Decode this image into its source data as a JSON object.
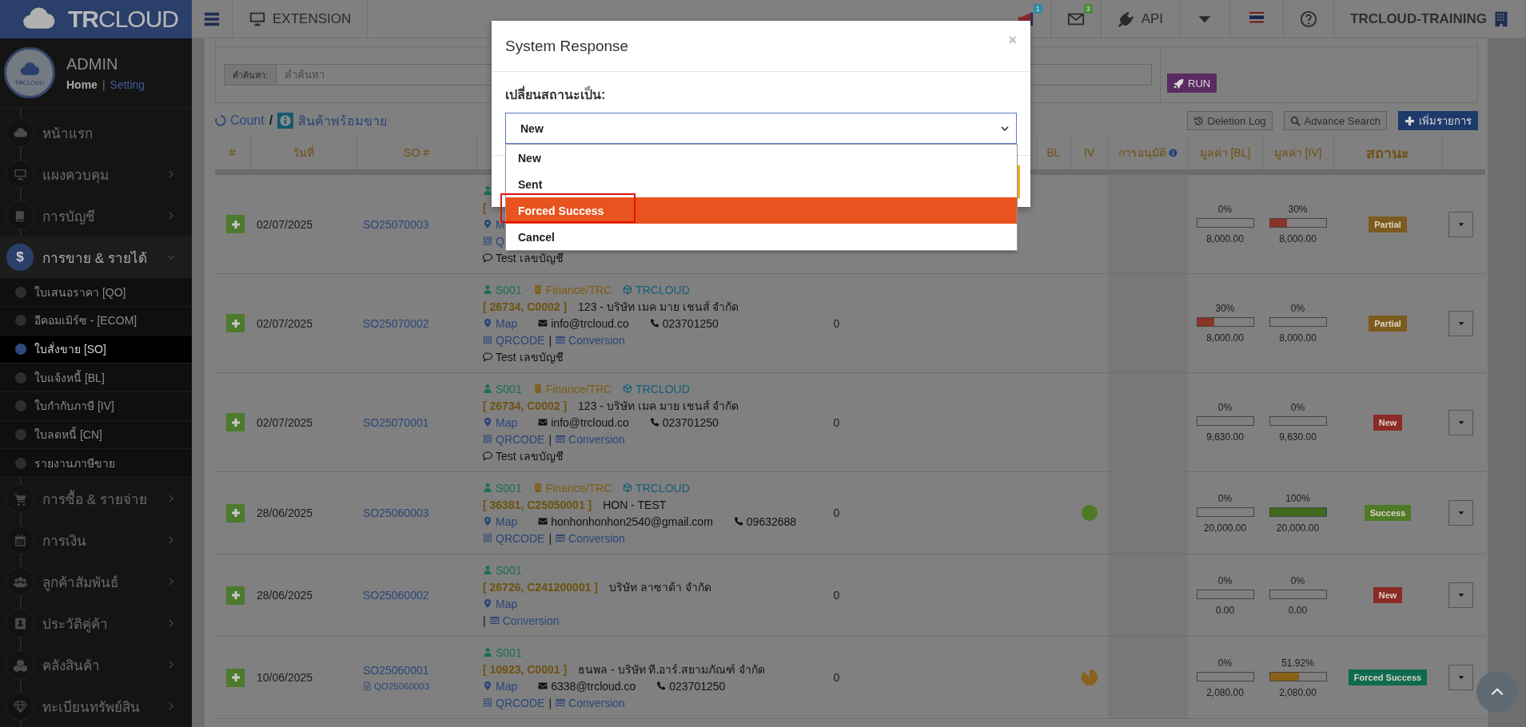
{
  "brand": {
    "logo": "**TR**CLOUD"
  },
  "topbar": {
    "extension": "EXTENSION",
    "items": [
      {
        "kind": "announce",
        "badge": "1",
        "color": "#2f8ea6"
      },
      {
        "kind": "mail",
        "badge": "3",
        "color": "#4a8a34"
      },
      {
        "kind": "api",
        "label": "API"
      },
      {
        "kind": "caret"
      },
      {
        "kind": "flag"
      },
      {
        "kind": "help"
      },
      {
        "kind": "company",
        "label": "TRCLOUD-TRAINING"
      }
    ]
  },
  "sidebar": {
    "profile": {
      "logo": "**TR**CLOUD",
      "name": "ADMIN",
      "links": [
        "Home",
        "Setting"
      ],
      "separator": "|"
    },
    "items": [
      {
        "label": "หน้าแรก",
        "kind": "cloud",
        "expandable": false,
        "expanded": false
      },
      {
        "label": "แผงควบคุม",
        "kind": "monitor",
        "expandable": true,
        "expanded": false
      },
      {
        "label": "การบัญชี",
        "kind": "book",
        "expandable": true,
        "expanded": false
      },
      {
        "label": "การขาย & รายได้",
        "kind": "dollar",
        "glyph": "$",
        "expandable": true,
        "expanded": true,
        "children": [
          {
            "label": "ใบเสนอราคา [QO]",
            "selected": false
          },
          {
            "label": "อีคอมเมิร์ซ - [ECOM]",
            "selected": false
          },
          {
            "label": "ใบสั่งขาย [SO]",
            "selected": true
          },
          {
            "label": "ใบแจ้งหนี้ [BL]",
            "selected": false
          },
          {
            "label": "ใบกำกับภาษี [IV]",
            "selected": false
          },
          {
            "label": "ใบลดหนี้ [CN]",
            "selected": false
          },
          {
            "label": "รายงานภาษีขาย",
            "selected": false
          }
        ]
      },
      {
        "label": "การซื้อ & รายจ่าย",
        "kind": "cart",
        "expandable": true,
        "expanded": false
      },
      {
        "label": "การเงิน",
        "kind": "calendar",
        "expandable": true,
        "expanded": false
      },
      {
        "label": "ลูกค้าสัมพันธ์",
        "kind": "users",
        "expandable": true,
        "expanded": false
      },
      {
        "label": "ประวัติคู่ค้า",
        "kind": "contact",
        "expandable": true,
        "expanded": false
      },
      {
        "label": "คลังสินค้า",
        "kind": "boxes",
        "expandable": true,
        "expanded": false
      },
      {
        "label": "ทะเบียนทรัพย์สิน",
        "kind": "diamond",
        "expandable": true,
        "expanded": false
      }
    ]
  },
  "filter": {
    "search_label": "คำค้นหา:",
    "placeholder": "คำค้นหา",
    "run": "RUN"
  },
  "toolbar": {
    "count": "Count",
    "slash": "/",
    "stock": "สินค้าพร้อมขาย",
    "buttons": [
      {
        "kind": "history",
        "label": "Deletion Log"
      },
      {
        "kind": "search",
        "label": "Advance Search"
      },
      {
        "kind": "add",
        "label": "เพิ่มรายการ"
      }
    ]
  },
  "table": {
    "columns": [
      {
        "label": "#"
      },
      {
        "label": "วันที่"
      },
      {
        "label": "SO #"
      },
      {
        "label": "BL"
      },
      {
        "label": "IV"
      },
      {
        "label": "การอนุมัติ",
        "info": true
      },
      {
        "label": "มูลค่า [BL]"
      },
      {
        "label": "มูลค่า [IV]"
      },
      {
        "label": "สถานะ"
      }
    ],
    "rows": [
      {
        "date": "02/07/2025",
        "so": "SO25070003",
        "lines": [
          [
            {
              "kind": "person"
            }
          ],
          [
            {
              "kind": "code",
              "text": "["
            }
          ],
          [
            {
              "kind": "map",
              "text": "M"
            }
          ],
          [
            {
              "kind": "qr",
              "text": "Q"
            }
          ],
          [
            {
              "kind": "note",
              "text": "Test เลขบัญชี"
            }
          ]
        ],
        "bl": {
          "pct": "0%",
          "level": 0,
          "amount": "8,000.00"
        },
        "iv": {
          "pct": "30%",
          "level": 0.3,
          "color": "#8a3424",
          "amount": "8,000.00"
        },
        "status": {
          "text": "Partial",
          "color": "#7d5a1e"
        }
      },
      {
        "date": "02/07/2025",
        "so": "SO25070002",
        "lines": [
          [
            {
              "kind": "person",
              "text": "S001"
            },
            {
              "kind": "dept",
              "text": "Finance/TRC"
            },
            {
              "kind": "company",
              "text": "TRCLOUD"
            }
          ],
          [
            {
              "kind": "code",
              "text": "[ 26734, C0002 ]"
            },
            {
              "kind": "name",
              "text": "123 - บริษัท เมค มาย เชนส์ จำกัด"
            }
          ],
          [
            {
              "kind": "map",
              "text": "Map"
            },
            {
              "kind": "email",
              "text": "info@trcloud.co"
            },
            {
              "kind": "phone",
              "text": "023701250"
            }
          ],
          [
            {
              "kind": "qr",
              "text": "QRCODE"
            },
            {
              "kind": "sep",
              "text": "|"
            },
            {
              "kind": "conv",
              "text": "Conversion"
            }
          ],
          [
            {
              "kind": "note",
              "text": "Test เลขบัญชี"
            }
          ]
        ],
        "qty": "0",
        "bl": {
          "pct": "30%",
          "level": 0.3,
          "color": "#8a3424",
          "amount": "8,000.00"
        },
        "iv": {
          "pct": "0%",
          "level": 0,
          "amount": "8,000.00"
        },
        "status": {
          "text": "Partial",
          "color": "#7d5a1e"
        }
      },
      {
        "date": "02/07/2025",
        "so": "SO25070001",
        "lines": [
          [
            {
              "kind": "person",
              "text": "S001"
            },
            {
              "kind": "dept",
              "text": "Finance/TRC"
            },
            {
              "kind": "company",
              "text": "TRCLOUD"
            }
          ],
          [
            {
              "kind": "code",
              "text": "[ 26734, C0002 ]"
            },
            {
              "kind": "name",
              "text": "123 - บริษัท เมค มาย เชนส์ จำกัด"
            }
          ],
          [
            {
              "kind": "map",
              "text": "Map"
            },
            {
              "kind": "email",
              "text": "info@trcloud.co"
            },
            {
              "kind": "phone",
              "text": "023701250"
            }
          ],
          [
            {
              "kind": "qr",
              "text": "QRCODE"
            },
            {
              "kind": "sep",
              "text": "|"
            },
            {
              "kind": "conv",
              "text": "Conversion"
            }
          ],
          [
            {
              "kind": "note",
              "text": "Test เลขบัญชี"
            }
          ]
        ],
        "qty": "0",
        "bl": {
          "pct": "0%",
          "level": 0,
          "amount": "9,630.00"
        },
        "iv": {
          "pct": "0%",
          "level": 0,
          "amount": "9,630.00"
        },
        "status": {
          "text": "New",
          "color": "#8c2a26"
        }
      },
      {
        "date": "28/06/2025",
        "so": "SO25060003",
        "lines": [
          [
            {
              "kind": "person",
              "text": "S001"
            },
            {
              "kind": "dept",
              "text": "Finance/TRC"
            },
            {
              "kind": "company",
              "text": "TRCLOUD"
            }
          ],
          [
            {
              "kind": "code",
              "text": "[ 36381, C25050001 ]"
            },
            {
              "kind": "name",
              "text": "HON - TEST"
            }
          ],
          [
            {
              "kind": "map",
              "text": "Map"
            },
            {
              "kind": "email",
              "text": "honhonhonhon2540@gmail.com"
            },
            {
              "kind": "phone",
              "text": "09632688"
            }
          ],
          [
            {
              "kind": "qr",
              "text": "QRCODE"
            },
            {
              "kind": "sep",
              "text": "|"
            },
            {
              "kind": "conv",
              "text": "Conversion"
            }
          ]
        ],
        "qty": "0",
        "iv_dot": {
          "kind": "full",
          "color": "#4e7a26"
        },
        "bl": {
          "pct": "0%",
          "level": 0,
          "amount": "20,000.00"
        },
        "iv": {
          "pct": "100%",
          "level": 1,
          "color": "#3f6a1e",
          "amount": "20,000.00"
        },
        "status": {
          "text": "Success",
          "color": "#4e7a26"
        }
      },
      {
        "date": "28/06/2025",
        "so": "SO25060002",
        "lines": [
          [
            {
              "kind": "person",
              "text": "S001"
            }
          ],
          [
            {
              "kind": "code",
              "text": "[ 26726, C241200001 ]"
            },
            {
              "kind": "name",
              "text": "บริษัท ลาซาด้า จำกัด"
            }
          ],
          [
            {
              "kind": "map",
              "text": "Map"
            }
          ],
          [
            {
              "kind": "sep",
              "text": "|"
            },
            {
              "kind": "conv",
              "text": "Conversion"
            }
          ]
        ],
        "qty": "0",
        "bl": {
          "pct": "0%",
          "level": 0,
          "amount": "0.00"
        },
        "iv": {
          "pct": "0%",
          "level": 0,
          "amount": "0.00"
        },
        "status": {
          "text": "New",
          "color": "#8c2a26"
        }
      },
      {
        "date": "10/06/2025",
        "so": "SO25060001",
        "ref": "QO25060003",
        "lines": [
          [
            {
              "kind": "person",
              "text": "S001"
            }
          ],
          [
            {
              "kind": "code",
              "text": "[ 10923, C0001 ]"
            },
            {
              "kind": "name",
              "text": "ธนพล - บริษัท ที.อาร์.สยามภัณฑ์ จำกัด"
            }
          ],
          [
            {
              "kind": "map",
              "text": "Map"
            },
            {
              "kind": "email",
              "text": "6338@trcloud.co"
            },
            {
              "kind": "phone",
              "text": "023701250"
            }
          ],
          [
            {
              "kind": "qr",
              "text": "QRCODE"
            },
            {
              "kind": "sep",
              "text": "|"
            },
            {
              "kind": "conv",
              "text": "Conversion"
            }
          ]
        ],
        "qty": "0",
        "iv_dot": {
          "kind": "partial",
          "color": "#8a6218"
        },
        "bl": {
          "pct": "0%",
          "level": 0,
          "amount": "2,080.00"
        },
        "iv": {
          "pct": "51.92%",
          "level": 0.5192,
          "color": "#8a6218",
          "amount": "2,080.00"
        },
        "status": {
          "text": "Forced Success",
          "color": "#0f6a50"
        }
      }
    ]
  },
  "modal": {
    "title": "System Response",
    "close": "×",
    "label": "เปลี่ยนสถานะเป็น:",
    "select": {
      "value": "New",
      "expanded": true
    },
    "options": [
      {
        "label": "New",
        "highlighted": false,
        "marked": false
      },
      {
        "label": "Sent",
        "highlighted": false,
        "marked": false
      },
      {
        "label": "Forced Success",
        "highlighted": true,
        "marked": true
      },
      {
        "label": "Cancel",
        "highlighted": false,
        "marked": false
      }
    ]
  }
}
